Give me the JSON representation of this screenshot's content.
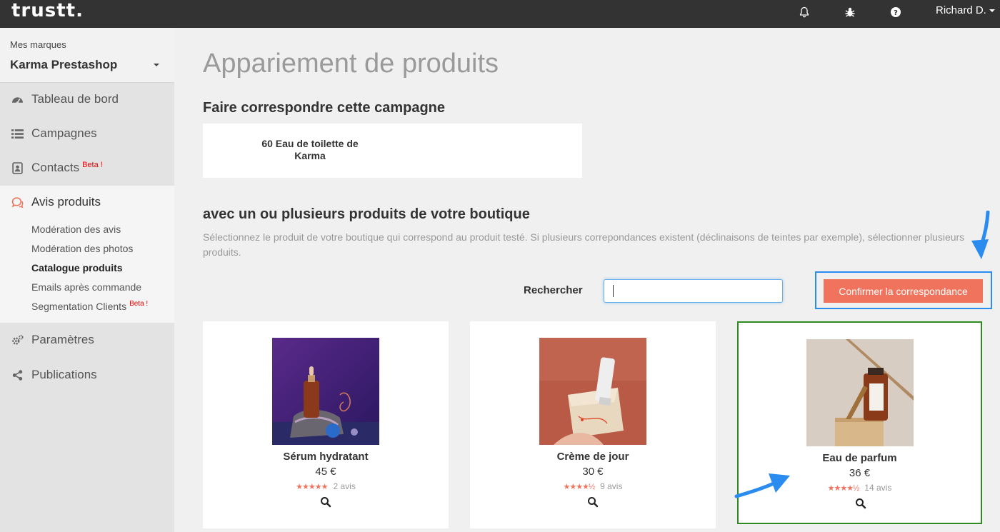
{
  "topbar": {
    "logo": "trustt.",
    "user": "Richard D."
  },
  "icons": {
    "bell": "bell-icon",
    "bug": "bug-icon",
    "help": "help-icon"
  },
  "sidebar": {
    "brand_caption": "Mes marques",
    "brand_name": "Karma Prestashop",
    "items": [
      {
        "label": "Tableau de bord",
        "icon": "dashboard-icon"
      },
      {
        "label": "Campagnes",
        "icon": "list-icon"
      },
      {
        "label": "Contacts",
        "icon": "contacts-icon",
        "badge": "Beta !"
      },
      {
        "label": "Avis produits",
        "icon": "chat-icon",
        "active": true
      },
      {
        "label": "Paramètres",
        "icon": "gears-icon"
      },
      {
        "label": "Publications",
        "icon": "share-icon"
      }
    ],
    "sub_items": [
      {
        "label": "Modération des avis"
      },
      {
        "label": "Modération des photos"
      },
      {
        "label": "Catalogue produits",
        "current": true
      },
      {
        "label": "Emails après commande"
      },
      {
        "label": "Segmentation Clients",
        "badge": "Beta !"
      }
    ]
  },
  "main": {
    "title": "Appariement de produits",
    "campaign_heading": "Faire correspondre cette campagne",
    "campaign_name": "60 Eau de toilette de Karma",
    "match_heading": "avec un ou plusieurs produits de votre boutique",
    "description": "Sélectionnez le produit de votre boutique qui correspond au produit testé. Si plusieurs correpondances existent (déclinaisons de teintes par exemple), sélectionner plusieurs produits.",
    "search_label": "Rechercher",
    "search_value": "",
    "confirm_label": "Confirmer la correspondance"
  },
  "products": [
    {
      "name": "Sérum hydratant",
      "price": "45 €",
      "stars": "★★★★★",
      "rating": 5,
      "reviews": "2 avis",
      "selected": false
    },
    {
      "name": "Crème de jour",
      "price": "30 €",
      "stars": "★★★★½",
      "rating": 4.5,
      "reviews": "9 avis",
      "selected": false
    },
    {
      "name": "Eau de parfum",
      "price": "36 €",
      "stars": "★★★★½",
      "rating": 4.5,
      "reviews": "14 avis",
      "selected": true
    }
  ],
  "colors": {
    "accent": "#f0735e",
    "topbar": "#333333",
    "highlight": "#2b8cf0",
    "selected_border": "#2e8b1f"
  }
}
